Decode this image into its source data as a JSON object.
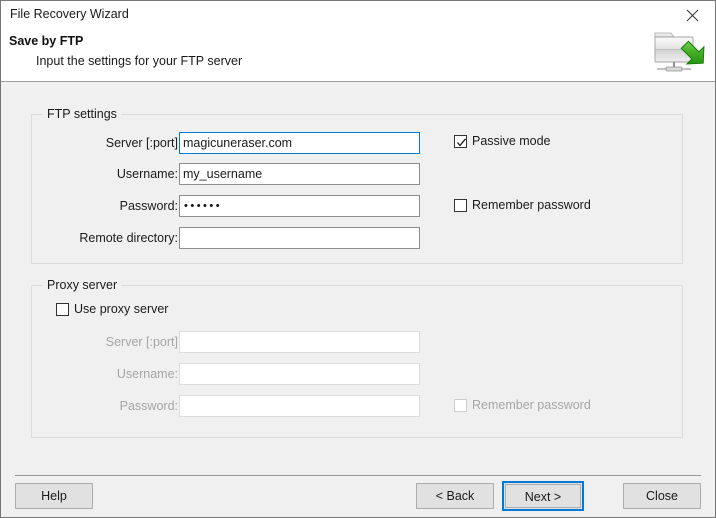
{
  "window": {
    "title": "File Recovery Wizard",
    "close_icon": "close-icon"
  },
  "header": {
    "title": "Save by FTP",
    "subtitle": "Input the settings for your FTP server",
    "icon": "network-folder-save-icon"
  },
  "ftp_settings": {
    "group_label": "FTP settings",
    "fields": [
      {
        "label": "Server [:port]",
        "value": "magicuneraser.com",
        "focused": true
      },
      {
        "label": "Username:",
        "value": "my_username",
        "focused": false
      },
      {
        "label": "Password:",
        "value": "••••••",
        "focused": false
      },
      {
        "label": "Remote directory:",
        "value": "",
        "focused": false
      }
    ],
    "passive_mode": {
      "label": "Passive mode",
      "checked": true
    },
    "remember_password": {
      "label": "Remember password",
      "checked": false
    }
  },
  "proxy_server": {
    "group_label": "Proxy server",
    "use_proxy": {
      "label": "Use proxy server",
      "checked": false
    },
    "fields": [
      {
        "label": "Server [:port]",
        "value": ""
      },
      {
        "label": "Username:",
        "value": ""
      },
      {
        "label": "Password:",
        "value": ""
      }
    ],
    "remember_password": {
      "label": "Remember password",
      "checked": false
    }
  },
  "footer": {
    "help": "Help",
    "back": "< Back",
    "next": "Next >",
    "close": "Close"
  },
  "colors": {
    "accent": "#0078d7",
    "window_bg": "#f0f0f0",
    "header_bg": "#ffffff"
  }
}
